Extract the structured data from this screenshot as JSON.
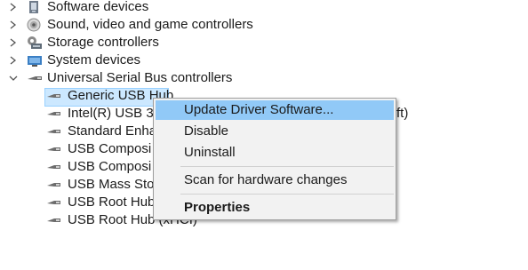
{
  "tree": {
    "categories": [
      {
        "label": "Software devices",
        "expanded": false,
        "icon": "software-devices-icon"
      },
      {
        "label": "Sound, video and game controllers",
        "expanded": false,
        "icon": "speaker-icon"
      },
      {
        "label": "Storage controllers",
        "expanded": false,
        "icon": "storage-controller-icon"
      },
      {
        "label": "System devices",
        "expanded": false,
        "icon": "system-devices-icon"
      },
      {
        "label": "Universal Serial Bus controllers",
        "expanded": true,
        "icon": "usb-icon"
      }
    ],
    "usb_children": [
      {
        "label": "Generic USB Hub",
        "selected": true
      },
      {
        "label": "Intel(R) USB 3",
        "tail": "ft)"
      },
      {
        "label": "Standard Enha"
      },
      {
        "label": "USB Composi"
      },
      {
        "label": "USB Composi"
      },
      {
        "label": "USB Mass Sto"
      },
      {
        "label": "USB Root Hub"
      },
      {
        "label": "USB Root Hub (xHCI)"
      }
    ]
  },
  "context_menu": {
    "items": [
      {
        "label": "Update Driver Software...",
        "hover": true,
        "bold": false
      },
      {
        "label": "Disable",
        "hover": false,
        "bold": false
      },
      {
        "label": "Uninstall",
        "hover": false,
        "bold": false
      },
      {
        "label": "Scan for hardware changes",
        "hover": false,
        "bold": false
      },
      {
        "label": "Properties",
        "hover": false,
        "bold": true
      }
    ]
  },
  "colors": {
    "selection_bg": "#cce8ff",
    "menu_hover": "#91c9f7",
    "menu_bg": "#f2f2f2"
  }
}
